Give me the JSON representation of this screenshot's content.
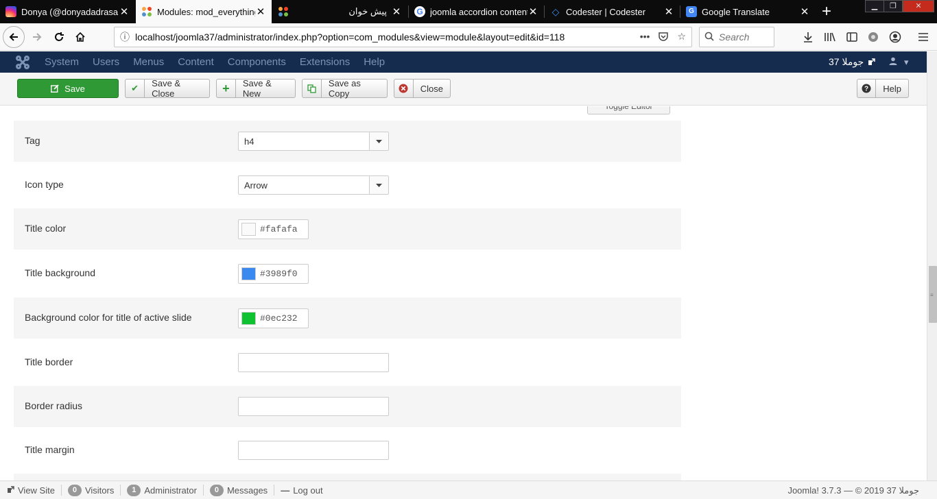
{
  "browser": {
    "tabs": [
      {
        "title": "Donya (@donyadadrasan)",
        "icon": "instagram-icon",
        "color": "#d6249f",
        "active": false
      },
      {
        "title": "Modules: mod_everything",
        "icon": "joomla-icon",
        "color": "#f44321",
        "active": true
      },
      {
        "title": "",
        "icon": "joomla-icon",
        "color": "#f44321",
        "active": false
      },
      {
        "title": "پیش خوان",
        "icon": "",
        "color": "",
        "active": false
      },
      {
        "title": "joomla accordion content",
        "icon": "google-icon",
        "color": "#4285f4",
        "active": false
      },
      {
        "title": "Codester | Codester",
        "icon": "codester-icon",
        "color": "#2c7be5",
        "active": false
      },
      {
        "title": "Google Translate",
        "icon": "google-translate-icon",
        "color": "#4285f4",
        "active": false
      }
    ],
    "url": "localhost/joomla37/administrator/index.php?option=com_modules&view=module&layout=edit&id=118",
    "search_placeholder": "Search"
  },
  "joomla": {
    "menu": [
      "System",
      "Users",
      "Menus",
      "Content",
      "Components",
      "Extensions",
      "Help"
    ],
    "site_name": "جوملا 37",
    "toolbar": {
      "save": "Save",
      "save_close": "Save & Close",
      "save_new": "Save & New",
      "save_copy": "Save as Copy",
      "close": "Close",
      "help": "Help"
    },
    "toggle_editor": "Toggle Editor",
    "fields": {
      "tag": {
        "label": "Tag",
        "value": "h4"
      },
      "icon_type": {
        "label": "Icon type",
        "value": "Arrow"
      },
      "title_color": {
        "label": "Title color",
        "value": "#fafafa",
        "swatch": "#fafafa"
      },
      "title_background": {
        "label": "Title background",
        "value": "#3989f0",
        "swatch": "#3989f0"
      },
      "active_bg": {
        "label": "Background color for title of active slide",
        "value": "#0ec232",
        "swatch": "#0ec232"
      },
      "title_border": {
        "label": "Title border",
        "value": ""
      },
      "border_radius": {
        "label": "Border radius",
        "value": ""
      },
      "title_margin": {
        "label": "Title margin",
        "value": ""
      }
    },
    "status": {
      "view_site": "View Site",
      "visitors_count": "0",
      "visitors": "Visitors",
      "admin_count": "1",
      "admin": "Administrator",
      "messages_count": "0",
      "messages": "Messages",
      "logout": "Log out",
      "copyright": "Joomla! 3.7.3 — © 2019 جوملا 37"
    }
  }
}
